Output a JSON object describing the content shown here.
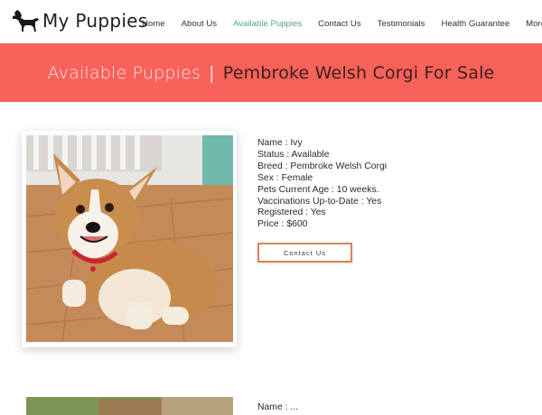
{
  "header": {
    "logo_text": "My Puppies",
    "logo_icon": "dog-silhouette-icon",
    "nav": [
      {
        "label": "Home"
      },
      {
        "label": "About Us"
      },
      {
        "label": "Available Puppies",
        "active": true
      },
      {
        "label": "Contact Us"
      },
      {
        "label": "Testimonials"
      },
      {
        "label": "Health Guarantee"
      },
      {
        "label": "More"
      }
    ],
    "active_color": "#57a57e"
  },
  "banner": {
    "part1": "Available Puppies",
    "separator": "|",
    "part2": "Pembroke Welsh Corgi For Sale",
    "background": "#f9615b"
  },
  "puppy": {
    "name": "Name : Ivy",
    "status": "Status : Available",
    "breed": "Breed : Pembroke Welsh Corgi",
    "sex": "Sex : Female",
    "age": "Pets Current Age : 10 weeks.",
    "vaccinations": "Vaccinations Up-to-Date : Yes",
    "registered": "Registered : Yes",
    "price": "Price : $600",
    "contact_label": "Contact Us",
    "photo_icon": "corgi-puppy-photo"
  },
  "puppy2": {
    "name": "Name : ..."
  }
}
